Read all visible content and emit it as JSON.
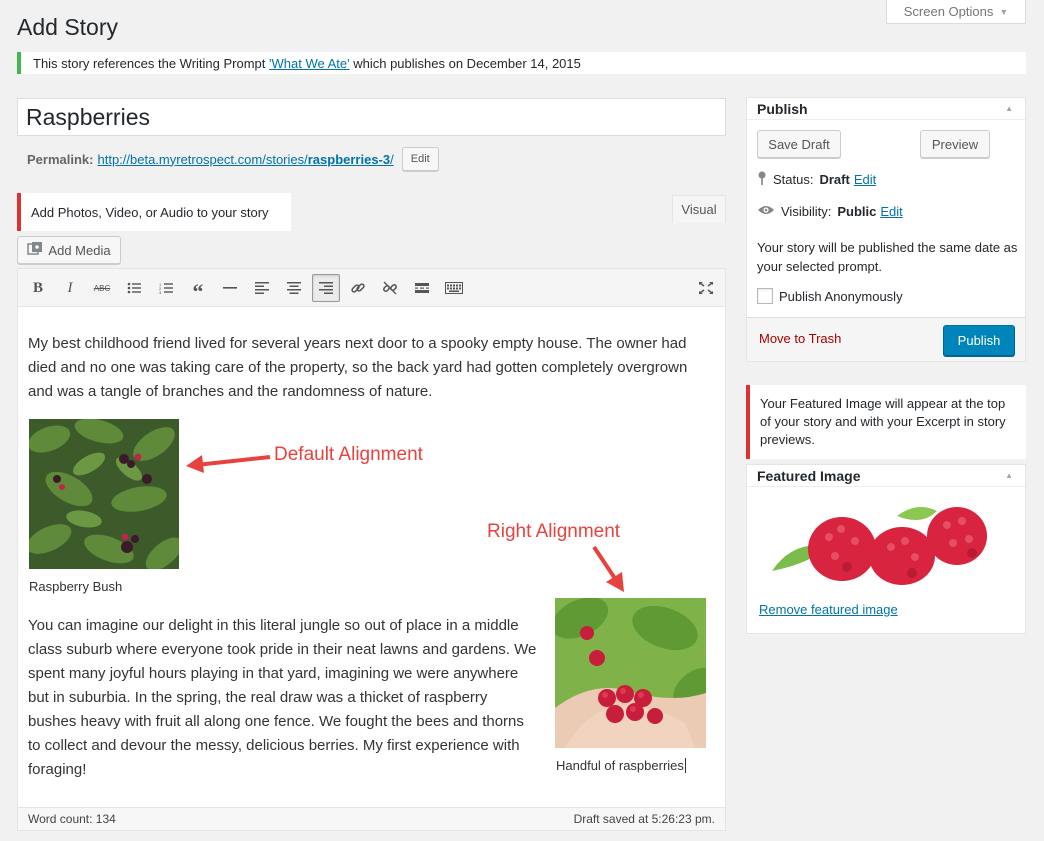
{
  "page": {
    "title": "Add Story",
    "screen_options": "Screen Options"
  },
  "notice": {
    "prefix": "This story references the Writing Prompt ",
    "prompt_link": "'What We Ate'",
    "suffix": " which publishes on December 14, 2015"
  },
  "post": {
    "title": "Raspberries",
    "permalink_label": "Permalink:",
    "permalink_url": "http://beta.myretrospect.com/stories/",
    "permalink_slug": "raspberries-3",
    "permalink_tail": "/",
    "edit_label": "Edit"
  },
  "media_notice": "Add Photos, Video, or Audio to your story",
  "editor": {
    "add_media_label": "Add Media",
    "visual_tab": "Visual",
    "toolbar_icons": [
      "bold-icon",
      "italic-icon",
      "strikethrough-icon",
      "bullet-list-icon",
      "numbered-list-icon",
      "blockquote-icon",
      "horizontal-line-icon",
      "align-left-icon",
      "align-center-icon",
      "align-right-icon",
      "insert-link-icon",
      "remove-link-icon",
      "read-more-icon",
      "toolbar-toggle-icon",
      "fullscreen-icon"
    ],
    "paragraph_1": "My best childhood friend lived for several years next door to a spooky empty house. The owner had died and no one was taking care of the property, so the back yard had gotten completely overgrown and was a tangle of branches and the randomness of nature.",
    "image_1_caption": "Raspberry Bush",
    "paragraph_2": "You can imagine our delight in this literal jungle so out of place in a middle class suburb where everyone took pride in their neat lawns and gardens. We spent many joyful hours playing in that yard, imagining we were anywhere but in suburbia. In the spring, the real draw was a thicket of raspberry bushes heavy with fruit all along one fence. We fought the bees and thorns to collect and devour the messy, delicious berries. My first experience with foraging!",
    "image_2_caption": "Handful of raspberries",
    "annotation_default": "Default Alignment",
    "annotation_right": "Right Alignment",
    "word_count": "Word count: 134",
    "draft_saved": "Draft saved at 5:26:23 pm."
  },
  "publish_box": {
    "heading": "Publish",
    "save_draft": "Save Draft",
    "preview": "Preview",
    "status_label": "Status:",
    "status_value": "Draft",
    "visibility_label": "Visibility:",
    "visibility_value": "Public",
    "edit_label": "Edit",
    "publish_note": "Your story will be published the same date as your selected prompt.",
    "anonymous_label": "Publish Anonymously",
    "trash_label": "Move to Trash",
    "publish_button": "Publish"
  },
  "featured": {
    "notice": "Your Featured Image will appear at the top of your story and with your Excerpt in story previews.",
    "heading": "Featured Image",
    "remove_link": "Remove featured image"
  },
  "colors": {
    "accent": "#0073aa",
    "primary_button": "#0085ba",
    "success_border": "#46b450",
    "error_border": "#dc3232",
    "annotation": "#e8423f"
  }
}
